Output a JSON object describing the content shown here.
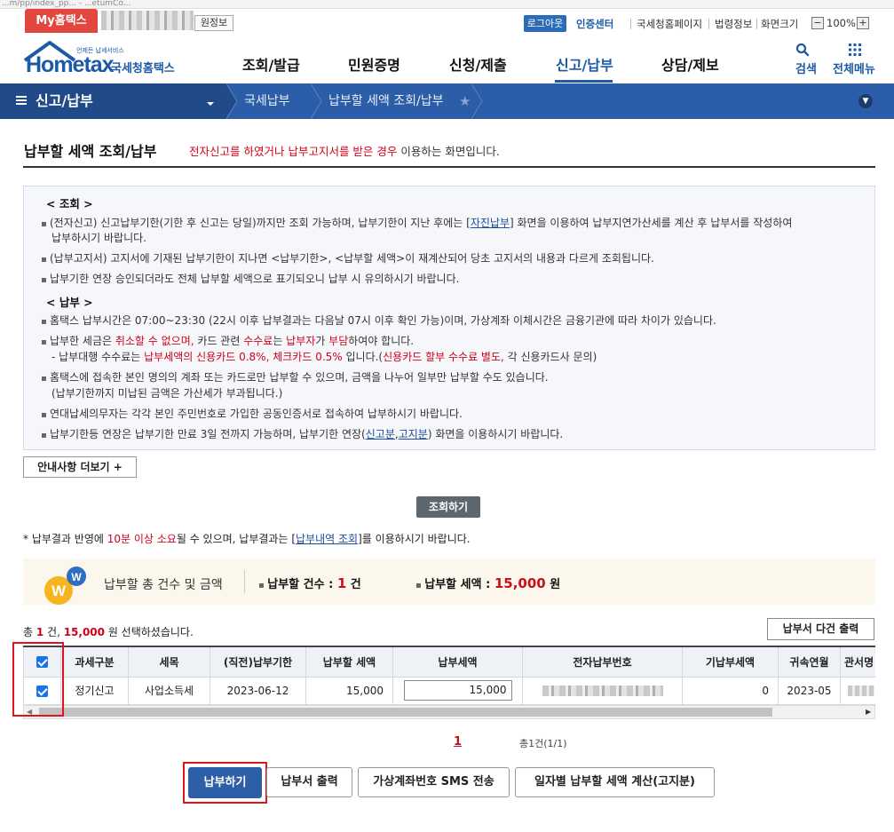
{
  "browser": {
    "url_fragment": "...m/pp/index_pp... - ...etumCo..."
  },
  "util": {
    "my_tab": "My홈택스",
    "my_info": "원정보",
    "logout": "로그아웃",
    "cert_center": "인증센터",
    "nts_page": "국세청홈페이지",
    "law_info": "법령정보",
    "zoom_label": "화면크기",
    "zoom_minus": "−",
    "zoom_value": "100%",
    "zoom_plus": "+"
  },
  "logo": {
    "tagline": "언제든 납세서비스",
    "name": "Hometax",
    "sub": "국세청홈택스"
  },
  "gnb": [
    {
      "label": "조회/발급"
    },
    {
      "label": "민원증명"
    },
    {
      "label": "신청/제출"
    },
    {
      "label": "신고/납부"
    },
    {
      "label": "상담/제보"
    }
  ],
  "top_icons": {
    "search": "검색",
    "all_menu": "전체메뉴"
  },
  "breadcrumb": {
    "menu": "신고/납부",
    "level1": "국세납부",
    "level2": "납부할 세액 조회/납부"
  },
  "page": {
    "title": "납부할 세액 조회/납부",
    "desc_red": "전자신고를 하였거나 납부고지서를 받은 경우",
    "desc_rest": " 이용하는 화면입니다."
  },
  "info": {
    "h1": "< 조회 >",
    "l1a": "(전자신고) 신고납부기한(기한 후 신고는 당일)까지만 조회 가능하며, 납부기한이 지난 후에는 [",
    "l1link": "자진납부",
    "l1b": "] 화면을 이용하여 납부지연가산세를 계산 후 납부서를 작성하여",
    "l1c": "납부하시기 바랍니다.",
    "l2": "(납부고지서) 고지서에 기재된 납부기한이 지나면 <납부기한>, <납부할 세액>이 재계산되어 당초 고지서의 내용과 다르게 조회됩니다.",
    "l3": "납부기한 연장 승인되더라도 전체 납부할 세액으로 표기되오니 납부 시 유의하시기 바랍니다.",
    "h2": "< 납부 >",
    "l4": "홈택스 납부시간은 07:00~23:30 (22시 이후 납부결과는 다음날 07시 이후 확인 가능)이며, 가상계좌 이체시간은 금융기관에 따라 차이가 있습니다.",
    "l5a": "납부한 세금은 ",
    "l5r1": "취소할 수 없으며,",
    "l5b": " 카드 관련 ",
    "l5r2": "수수료",
    "l5c": "는 ",
    "l5r3": "납부자",
    "l5d": "가 ",
    "l5r4": "부담",
    "l5e": "하여야 합니다.",
    "l6a": "- 납부대행 수수료는 ",
    "l6r1": "납부세액의 신용카드 0.8%, 체크카드 0.5%",
    "l6b": " 입니다.(",
    "l6r2": "신용카드 할부 수수료 별도,",
    "l6c": " 각 신용카드사 문의)",
    "l7": "홈택스에 접속한 본인 명의의 계좌 또는 카드로만 납부할 수 있으며, 금액을 나누어 일부만 납부할 수도 있습니다.",
    "l7b": "(납부기한까지 미납된 금액은 가산세가 부과됩니다.)",
    "l8": "연대납세의무자는 각각 본인 주민번호로 가입한 공동인증서로 접속하여 납부하시기 바랍니다.",
    "l9a": "납부기한등 연장은 납부기한 만료 3일 전까지 가능하며, 납부기한 연장(",
    "l9link1": "신고분",
    "l9comma": ",",
    "l9link2": "고지분",
    "l9b": ") 화면을 이용하시기 바랍니다."
  },
  "more_button": "안내사항 더보기 +",
  "search_button": "조회하기",
  "note": {
    "a": "* 납부결과 반영에 ",
    "red": "10분 이상 소요",
    "b": "될 수 있으며, 납부결과는 [",
    "link": "납부내역 조회",
    "c": "]를 이용하시기 바랍니다."
  },
  "summary": {
    "label": "납부할 총 건수 및 금액",
    "count_label": "납부할 건수 : ",
    "count_value": "1",
    "count_unit": " 건",
    "amount_label": "납부할 세액 : ",
    "amount_value": "15,000",
    "amount_unit": " 원"
  },
  "selected": {
    "a": "총 ",
    "count": "1",
    "b": " 건, ",
    "amount": "15,000",
    "c": " 원 선택하셨습니다."
  },
  "multi_print": "납부서 다건 출력",
  "table": {
    "headers": [
      "과세구분",
      "세목",
      "(직전)납부기한",
      "납부할 세액",
      "납부세액",
      "전자납부번호",
      "기납부세액",
      "귀속연월",
      "관서명"
    ],
    "row": {
      "kind": "정기신고",
      "tax": "사업소득세",
      "due": "2023-06-12",
      "to_pay": "15,000",
      "pay_input": "15,000",
      "prepaid": "0",
      "period": "2023-05"
    }
  },
  "pager": {
    "page": "1",
    "total": "총1건(1/1)"
  },
  "actions": {
    "pay": "납부하기",
    "print": "납부서 출력",
    "sms": "가상계좌번호 SMS 전송",
    "calc": "일자별 납부할 세액 계산(고지분)"
  },
  "colors": {
    "brand_blue": "#2b5da8",
    "accent_red": "#d0021b",
    "highlight_box": "#e0141e"
  }
}
